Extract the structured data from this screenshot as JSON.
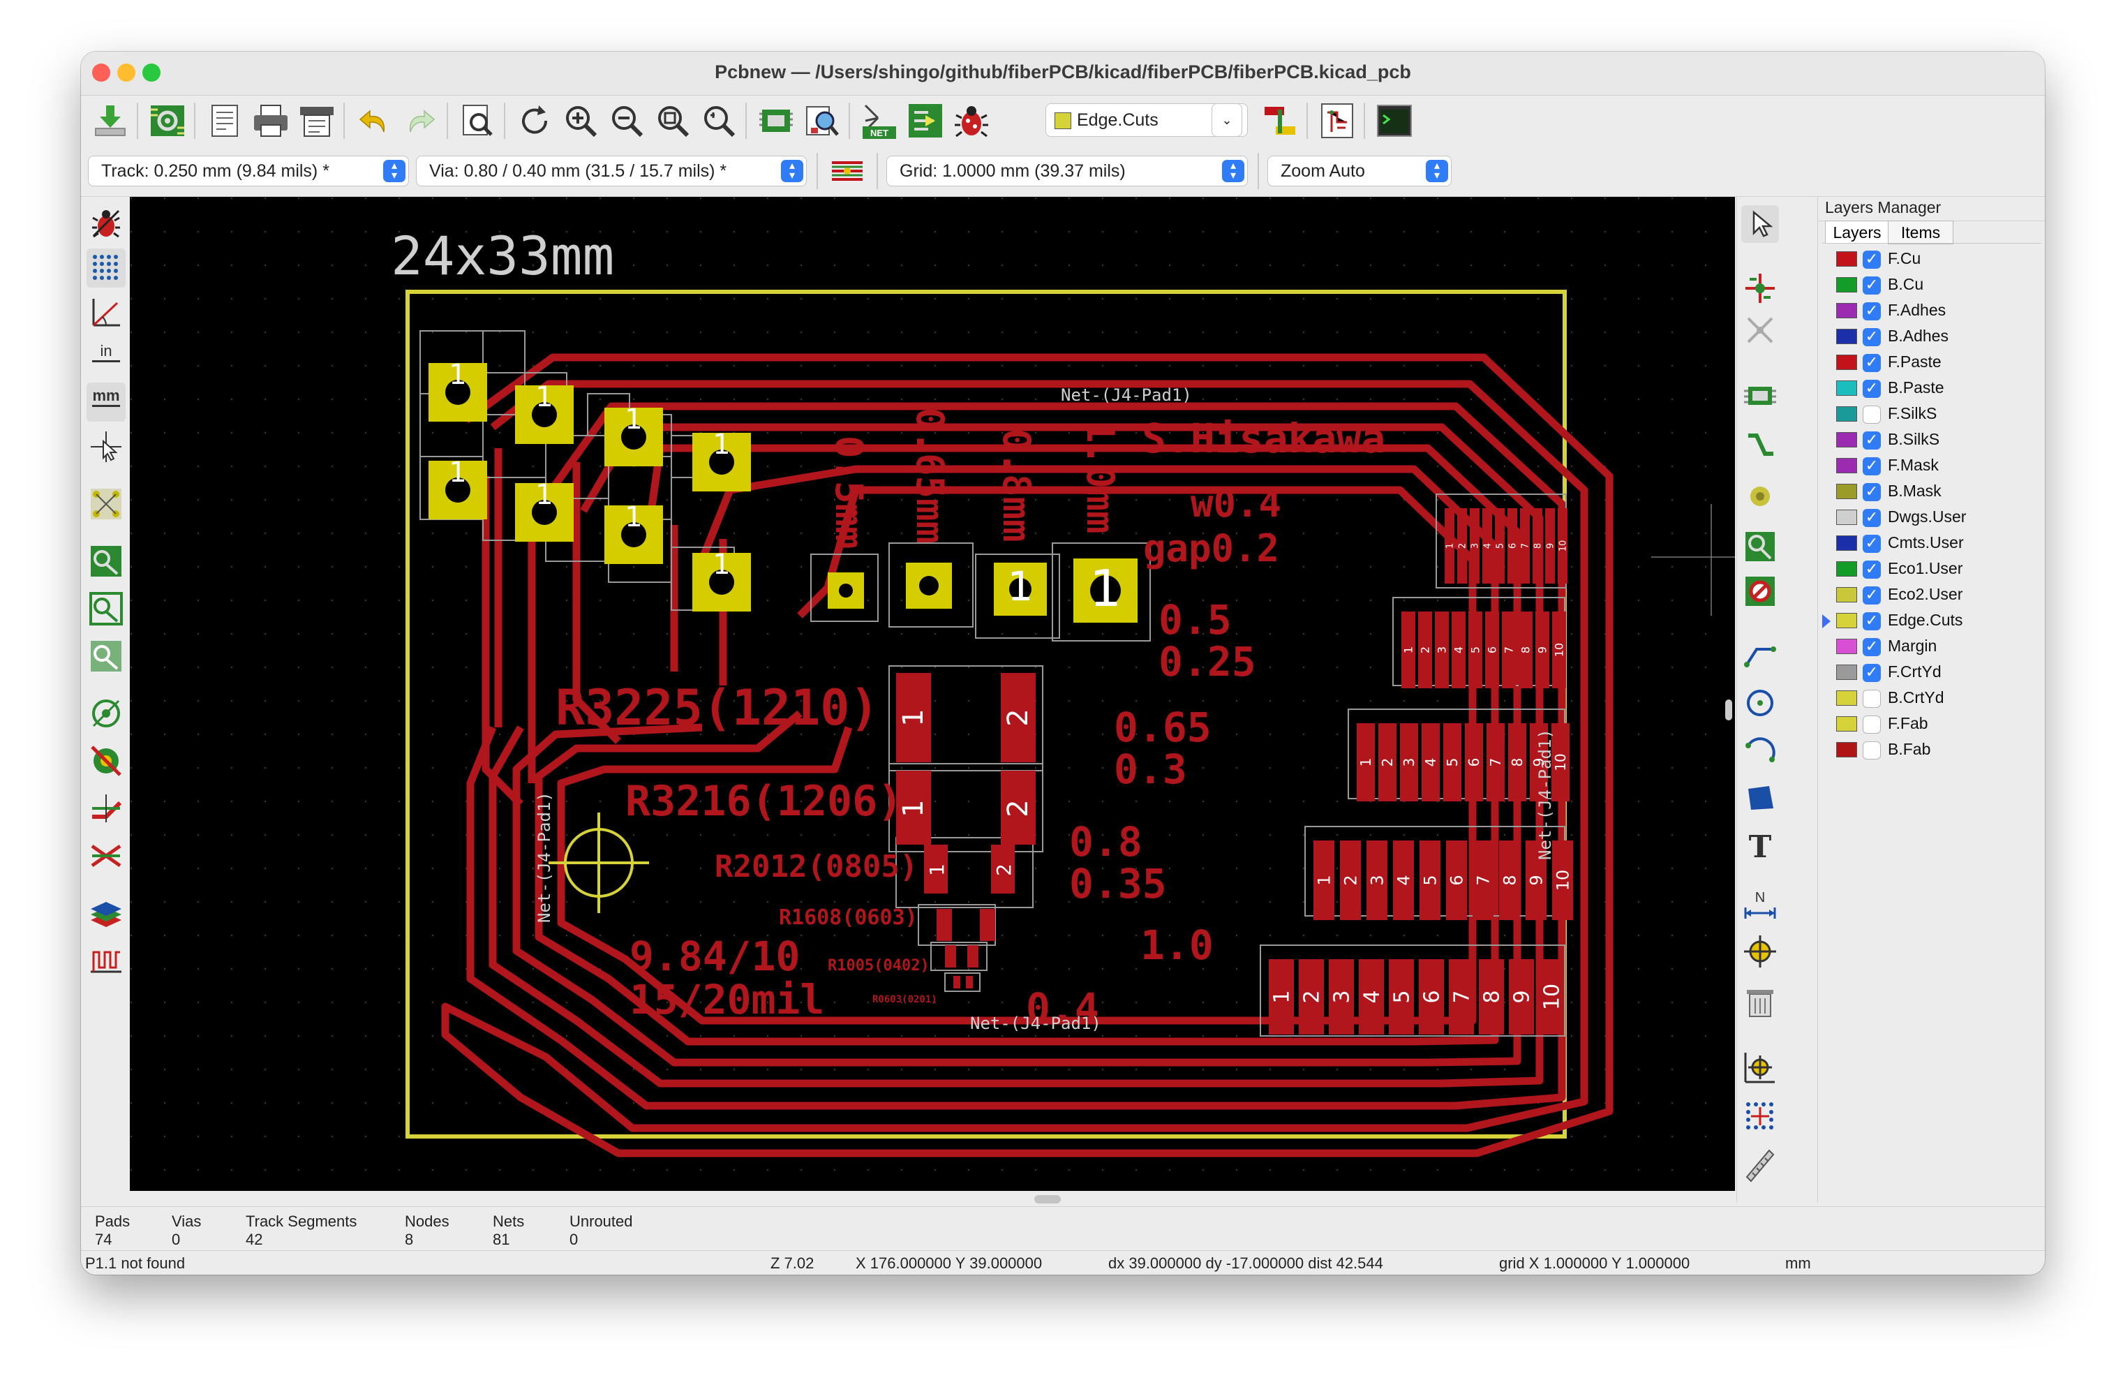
{
  "window": {
    "title": "Pcbnew — /Users/shingo/github/fiberPCB/kicad/fiberPCB/fiberPCB.kicad_pcb"
  },
  "toolbar": {
    "active_layer": "Edge.Cuts",
    "track": "Track: 0.250 mm (9.84 mils) *",
    "via": "Via: 0.80 / 0.40 mm (31.5 / 15.7 mils) *",
    "grid": "Grid: 1.0000 mm (39.37 mils)",
    "zoom": "Zoom Auto"
  },
  "left_toolbar": {
    "units_in": "in",
    "units_mm": "mm"
  },
  "board": {
    "title": "24x33mm",
    "author": "S.Hisakawa",
    "width_label": "w0.4",
    "gap_label": "gap0.2",
    "pad_sizes": [
      "0.5mm",
      "0.65mm",
      "0.8mm",
      "1.0mm"
    ],
    "resistors": [
      "R3225(1210)",
      "R3216(1206)",
      "R2012(0805)",
      "R1608(0603)",
      "R1005(0402)",
      "R0603(0201)"
    ],
    "track_label_1": "9.84/10",
    "track_label_2": "15/20mil",
    "pitch_labels": [
      {
        "pitch": "0.5",
        "gap": "0.25"
      },
      {
        "pitch": "0.65",
        "gap": "0.3"
      },
      {
        "pitch": "0.8",
        "gap": "0.35"
      },
      {
        "pitch": "1.0",
        "gap": "0.4"
      }
    ],
    "net_label": "Net-(J4-Pad1)",
    "pad_one": "1",
    "pad_two": "2",
    "pin_numbers": [
      "1",
      "2",
      "3",
      "4",
      "5",
      "6",
      "7",
      "8",
      "9",
      "10"
    ]
  },
  "layers_manager": {
    "title": "Layers Manager",
    "tabs": [
      "Layers",
      "Items"
    ],
    "active_layer": "Edge.Cuts",
    "layers": [
      {
        "name": "F.Cu",
        "color": "#c3131a",
        "visible": true
      },
      {
        "name": "B.Cu",
        "color": "#149c28",
        "visible": true
      },
      {
        "name": "F.Adhes",
        "color": "#9b2bb0",
        "visible": true
      },
      {
        "name": "B.Adhes",
        "color": "#1a2fa8",
        "visible": true
      },
      {
        "name": "F.Paste",
        "color": "#c3131a",
        "visible": true
      },
      {
        "name": "B.Paste",
        "color": "#1bbdbd",
        "visible": true
      },
      {
        "name": "F.SilkS",
        "color": "#1b9a9a",
        "visible": false
      },
      {
        "name": "B.SilkS",
        "color": "#9b2bb0",
        "visible": true
      },
      {
        "name": "F.Mask",
        "color": "#9b2bb0",
        "visible": true
      },
      {
        "name": "B.Mask",
        "color": "#9b9b2a",
        "visible": true
      },
      {
        "name": "Dwgs.User",
        "color": "#cfcfcf",
        "visible": true
      },
      {
        "name": "Cmts.User",
        "color": "#1a2fa8",
        "visible": true
      },
      {
        "name": "Eco1.User",
        "color": "#149c28",
        "visible": true
      },
      {
        "name": "Eco2.User",
        "color": "#c9c83a",
        "visible": true
      },
      {
        "name": "Edge.Cuts",
        "color": "#d6d23a",
        "visible": true
      },
      {
        "name": "Margin",
        "color": "#d94fd4",
        "visible": true
      },
      {
        "name": "F.CrtYd",
        "color": "#9a9a9a",
        "visible": true
      },
      {
        "name": "B.CrtYd",
        "color": "#d6d23a",
        "visible": false
      },
      {
        "name": "F.Fab",
        "color": "#d6d23a",
        "visible": false
      },
      {
        "name": "B.Fab",
        "color": "#b01515",
        "visible": false
      }
    ]
  },
  "status": {
    "pads_label": "Pads",
    "pads": "74",
    "vias_label": "Vias",
    "vias": "0",
    "tracks_label": "Track Segments",
    "tracks": "42",
    "nodes_label": "Nodes",
    "nodes": "8",
    "nets_label": "Nets",
    "nets": "81",
    "unrouted_label": "Unrouted",
    "unrouted": "0",
    "message": "P1.1 not found",
    "zoom": "Z 7.02",
    "cursor": "X 176.000000  Y 39.000000",
    "delta": "dx 39.000000  dy -17.000000  dist 42.544",
    "grid": "grid X 1.000000  Y 1.000000",
    "units": "mm"
  }
}
